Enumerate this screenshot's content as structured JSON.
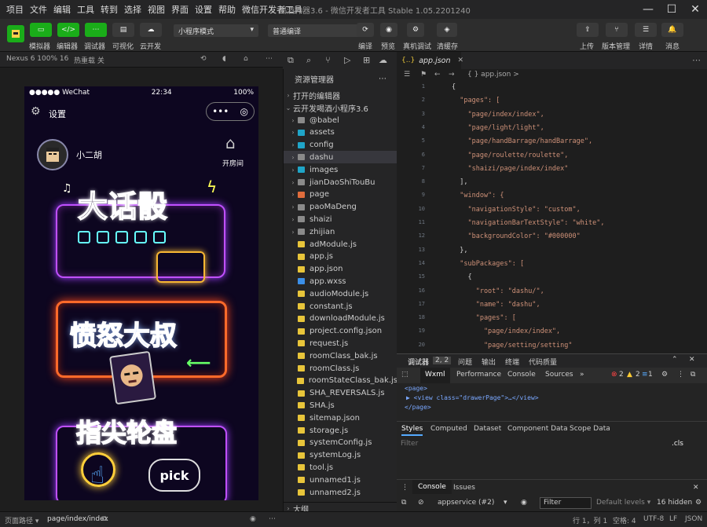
{
  "menu": [
    "项目",
    "文件",
    "编辑",
    "工具",
    "转到",
    "选择",
    "视图",
    "界面",
    "设置",
    "帮助",
    "微信开发者工具"
  ],
  "window_title": "喝酒神器3.6 - 微信开发者工具 Stable 1.05.2201240",
  "toolbar": {
    "buttons": [
      "模拟器",
      "编辑器",
      "调试器",
      "可视化",
      "云开发"
    ],
    "mode_select": "小程序模式",
    "compile_select": "普通编译",
    "actions": [
      "编译",
      "预览",
      "真机调试",
      "清缓存"
    ],
    "right_actions": [
      "上传",
      "版本管理",
      "详情",
      "消息"
    ]
  },
  "simulator": {
    "device": "Nexus 6 100% 16",
    "hotreload": "热重载 关",
    "status_left": "●●●●● WeChat",
    "status_time": "22:34",
    "status_right": "100%",
    "settings": "设置",
    "username": "小二胡",
    "open_room": "开房间",
    "game1": "大话骰",
    "game2": "愤怒大叔",
    "game3": "指尖轮盘",
    "pick": "pick"
  },
  "explorer": {
    "header": "资源管理器",
    "open_editors": "打开的编辑器",
    "project": "云开发喝酒小程序3.6",
    "items": [
      {
        "name": "@babel",
        "type": "folder",
        "color": "#8a8a8a"
      },
      {
        "name": "assets",
        "type": "folder",
        "color": "#1fa5c8"
      },
      {
        "name": "config",
        "type": "folder",
        "color": "#1fa5c8"
      },
      {
        "name": "dashu",
        "type": "folder",
        "color": "#8a8a8a"
      },
      {
        "name": "images",
        "type": "folder",
        "color": "#1fa5c8"
      },
      {
        "name": "jianDaoShiTouBu",
        "type": "folder",
        "color": "#8a8a8a"
      },
      {
        "name": "page",
        "type": "folder",
        "color": "#e06c3c"
      },
      {
        "name": "paoMaDeng",
        "type": "folder",
        "color": "#8a8a8a"
      },
      {
        "name": "shaizi",
        "type": "folder",
        "color": "#8a8a8a"
      },
      {
        "name": "zhijian",
        "type": "folder",
        "color": "#8a8a8a"
      },
      {
        "name": "adModule.js",
        "type": "file",
        "color": "#e8c53a"
      },
      {
        "name": "app.js",
        "type": "file",
        "color": "#e8c53a"
      },
      {
        "name": "app.json",
        "type": "file",
        "color": "#e8c53a"
      },
      {
        "name": "app.wxss",
        "type": "file",
        "color": "#3b8fe8"
      },
      {
        "name": "audioModule.js",
        "type": "file",
        "color": "#e8c53a"
      },
      {
        "name": "constant.js",
        "type": "file",
        "color": "#e8c53a"
      },
      {
        "name": "downloadModule.js",
        "type": "file",
        "color": "#e8c53a"
      },
      {
        "name": "project.config.json",
        "type": "file",
        "color": "#e8c53a"
      },
      {
        "name": "request.js",
        "type": "file",
        "color": "#e8c53a"
      },
      {
        "name": "roomClass_bak.js",
        "type": "file",
        "color": "#e8c53a"
      },
      {
        "name": "roomClass.js",
        "type": "file",
        "color": "#e8c53a"
      },
      {
        "name": "roomStateClass_bak.js",
        "type": "file",
        "color": "#e8c53a"
      },
      {
        "name": "SHA_REVERSALS.js",
        "type": "file",
        "color": "#e8c53a"
      },
      {
        "name": "SHA.js",
        "type": "file",
        "color": "#e8c53a"
      },
      {
        "name": "sitemap.json",
        "type": "file",
        "color": "#e8c53a"
      },
      {
        "name": "storage.js",
        "type": "file",
        "color": "#e8c53a"
      },
      {
        "name": "systemConfig.js",
        "type": "file",
        "color": "#e8c53a"
      },
      {
        "name": "systemLog.js",
        "type": "file",
        "color": "#e8c53a"
      },
      {
        "name": "tool.js",
        "type": "file",
        "color": "#e8c53a"
      },
      {
        "name": "unnamed1.js",
        "type": "file",
        "color": "#e8c53a"
      },
      {
        "name": "unnamed2.js",
        "type": "file",
        "color": "#e8c53a"
      }
    ],
    "outline": "大纲"
  },
  "editor": {
    "tab": "app.json",
    "breadcrumb": "{ } app.json >",
    "lines": [
      "{",
      "  \"pages\": [",
      "    \"page/index/index\",",
      "    \"page/light/light\",",
      "    \"page/handBarrage/handBarrage\",",
      "    \"page/roulette/roulette\",",
      "    \"shaizi/page/index/index\"",
      "  ],",
      "  \"window\": {",
      "    \"navigationStyle\": \"custom\",",
      "    \"navigationBarTextStyle\": \"white\",",
      "    \"backgroundColor\": \"#000000\"",
      "  },",
      "  \"subPackages\": [",
      "    {",
      "      \"root\": \"dashu/\",",
      "      \"name\": \"dashu\",",
      "      \"pages\": [",
      "        \"page/index/index\",",
      "        \"page/setting/setting\""
    ]
  },
  "devtools": {
    "top_tabs": [
      "调试器",
      "2, 2",
      "问题",
      "输出",
      "终端",
      "代码质量"
    ],
    "panel_tabs": [
      "Wxml",
      "Performance",
      "Console",
      "Sources",
      "»"
    ],
    "errors": "2",
    "warnings": "2",
    "infos": "1",
    "wxml_lines": [
      "<page>",
      "▶ <view class=\"drawerPage\">…</view>",
      "</page>"
    ],
    "style_tabs": [
      "Styles",
      "Computed",
      "Dataset",
      "Component Data",
      "Scope Data"
    ],
    "filter_placeholder": "Filter",
    "cls": ".cls",
    "console_tabs": [
      "Console",
      "Issues"
    ],
    "context": "appservice (#2)",
    "console_filter": "Filter",
    "levels": "Default levels ▾",
    "hidden": "16 hidden"
  },
  "statusbar": {
    "path_label": "页面路径 ▾",
    "path": "page/index/index",
    "position": "行 1，列 1",
    "spaces": "空格: 4",
    "encoding": "UTF-8",
    "eol": "LF",
    "lang": "JSON"
  }
}
